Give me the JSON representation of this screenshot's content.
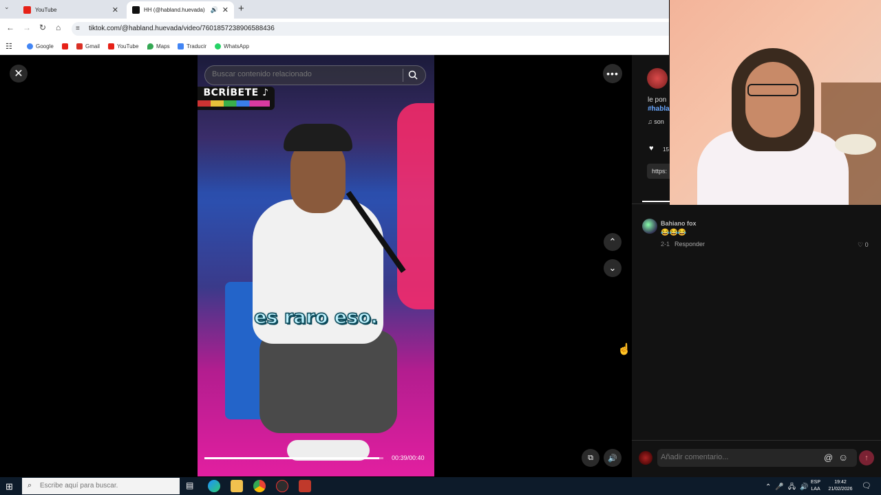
{
  "browser": {
    "tabs": [
      {
        "title": "YouTube",
        "favicon_color": "#e62117"
      },
      {
        "title": "HH (@habland.huevada) | T",
        "favicon_color": "#111111"
      }
    ],
    "new_tab_label": "+",
    "url": "tiktok.com/@habland.huevada/video/7601857238906588436",
    "bookmarks": [
      {
        "label": "Google",
        "color": "#4285f4"
      },
      {
        "label": "",
        "color": "#e62117"
      },
      {
        "label": "Gmail",
        "color": "#d93025"
      },
      {
        "label": "YouTube",
        "color": "#e62117"
      },
      {
        "label": "Maps",
        "color": "#34a853"
      },
      {
        "label": "Traducir",
        "color": "#4285f4"
      },
      {
        "label": "WhatsApp",
        "color": "#25d366"
      }
    ]
  },
  "video": {
    "search_placeholder": "Buscar contenido relacionado",
    "banner_text": "BCRÍBETE ♪",
    "caption": "es raro eso.",
    "time": "00:39/00:40",
    "progress": 0.975
  },
  "panel": {
    "desc_text": "le pon",
    "desc_tag": "#habla",
    "sound": "son",
    "like_count": "15",
    "link_text": "https:",
    "comments": [
      {
        "author": "Bahiano fox",
        "text": "😂😂😂",
        "date": "2-1",
        "reply": "Responder",
        "likes": "0"
      }
    ],
    "comment_placeholder": "Añadir comentario..."
  },
  "taskbar": {
    "search_placeholder": "Escribe aquí para buscar.",
    "lang_line1": "ESP",
    "lang_line2": "LAA",
    "time": "19:42",
    "date": "21/02/2026"
  },
  "icons": [
    "close-icon",
    "search-icon",
    "more-icon",
    "chevron-up-icon",
    "chevron-down-icon",
    "pip-icon",
    "volume-icon",
    "heart-icon",
    "music-icon",
    "at-icon",
    "emoji-icon",
    "send-icon",
    "windows-icon"
  ]
}
